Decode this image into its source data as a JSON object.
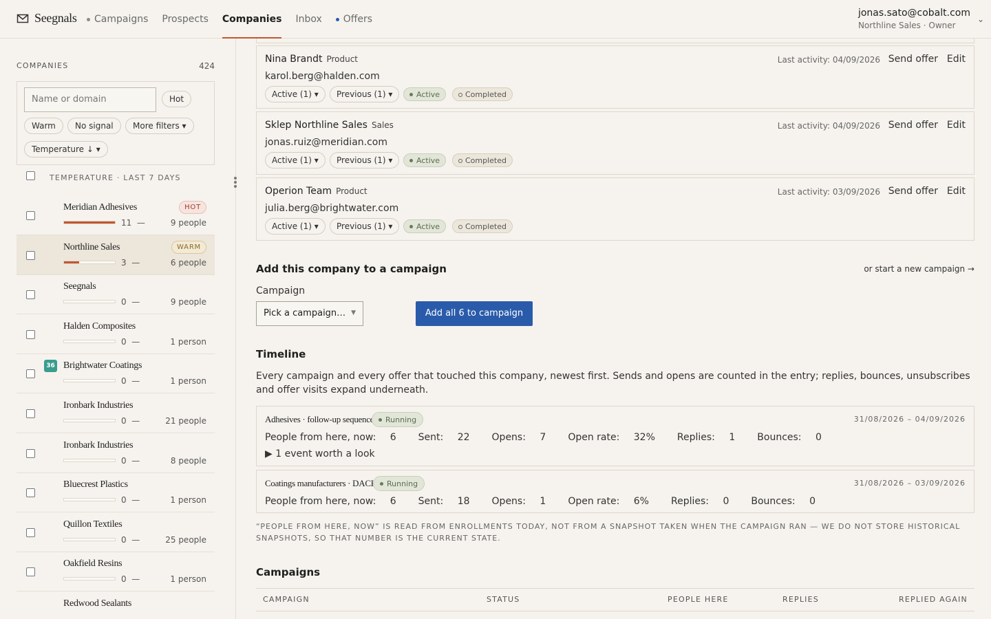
{
  "app": {
    "brand": "Seegnals",
    "nav": [
      {
        "label": "Campaigns",
        "dot": true,
        "dot_color": "#8a8a8a"
      },
      {
        "label": "Prospects",
        "dot": false
      },
      {
        "label": "Companies",
        "active": true
      },
      {
        "label": "Inbox",
        "dot": false
      },
      {
        "label": "Offers",
        "dot": true,
        "dot_color": "#2a5db0"
      }
    ],
    "account": {
      "email": "jonas.sato@cobalt.com",
      "org": "Northline Sales · Owner"
    }
  },
  "sidebar": {
    "title": "COMPANIES",
    "count": "424",
    "search_placeholder": "Name or domain",
    "chips": [
      "Hot",
      "Warm",
      "No signal",
      "More filters ▾",
      "Temperature ↓ ▾"
    ],
    "column_header": "TEMPERATURE · LAST 7 DAYS",
    "rows": [
      {
        "name": "Meridian Adhesives",
        "score": "11",
        "fill": 1.0,
        "people": "9 people",
        "badge": "HOT"
      },
      {
        "name": "Northline Sales",
        "score": "3",
        "fill": 0.3,
        "people": "6 people",
        "badge": "WARM",
        "selected": true
      },
      {
        "name": "Seegnals",
        "score": "0",
        "fill": 0,
        "people": "9 people"
      },
      {
        "name": "Halden Composites",
        "score": "0",
        "fill": 0,
        "people": "1 person"
      },
      {
        "name": "Brightwater Coatings",
        "score": "0",
        "fill": 0,
        "people": "1 person",
        "num": "36"
      },
      {
        "name": "Ironbark Industries",
        "score": "0",
        "fill": 0,
        "people": "21 people"
      },
      {
        "name": "Ironbark Industries",
        "score": "0",
        "fill": 0,
        "people": "8 people"
      },
      {
        "name": "Bluecrest Plastics",
        "score": "0",
        "fill": 0,
        "people": "1 person"
      },
      {
        "name": "Quillon Textiles",
        "score": "0",
        "fill": 0,
        "people": "25 people"
      },
      {
        "name": "Oakfield Resins",
        "score": "0",
        "fill": 0,
        "people": "1 person"
      },
      {
        "name": "Redwood Sealants",
        "score": "",
        "fill": 0,
        "people": ""
      }
    ],
    "dash": "—"
  },
  "people": [
    {
      "name": "Nina Brandt",
      "role": "Product",
      "email": "karol.berg@halden.com",
      "last": "Last activity: 04/09/2026"
    },
    {
      "name": "Sklep Northline Sales",
      "role": "Sales",
      "email": "jonas.ruiz@meridian.com",
      "last": "Last activity: 04/09/2026"
    },
    {
      "name": "Operion Team",
      "role": "Product",
      "email": "julia.berg@brightwater.com",
      "last": "Last activity: 03/09/2026"
    }
  ],
  "person_actions": {
    "send": "Send offer",
    "edit": "Edit",
    "active_pill": "Active (1) ▾",
    "previous_pill": "Previous (1) ▾",
    "status_active": "Active",
    "status_done": "Completed"
  },
  "add_campaign": {
    "title": "Add this company to a campaign",
    "new_link": "or start a new campaign →",
    "label": "Campaign",
    "select_value": "Pick a campaign…",
    "button": "Add all 6 to campaign"
  },
  "timeline": {
    "title": "Timeline",
    "description": "Every campaign and every offer that touched this company, newest first. Sends and opens are counted in the entry; replies, bounces, unsubscribes and offer visits expand underneath.",
    "entries": [
      {
        "name": "Adhesives · follow-up sequence",
        "status": "Running",
        "dates": "31/08/2026 – 04/09/2026",
        "stats": [
          [
            "People from here, now:",
            "6"
          ],
          [
            "Sent:",
            "22"
          ],
          [
            "Opens:",
            "7"
          ],
          [
            "Open rate:",
            "32%"
          ],
          [
            "Replies:",
            "1"
          ],
          [
            "Bounces:",
            "0"
          ]
        ],
        "expand": "▶  1 event worth a look"
      },
      {
        "name": "Coatings manufacturers · DACH",
        "status": "Running",
        "dates": "31/08/2026 – 03/09/2026",
        "stats": [
          [
            "People from here, now:",
            "6"
          ],
          [
            "Sent:",
            "18"
          ],
          [
            "Opens:",
            "1"
          ],
          [
            "Open rate:",
            "6%"
          ],
          [
            "Replies:",
            "0"
          ],
          [
            "Bounces:",
            "0"
          ]
        ]
      }
    ],
    "note": "“PEOPLE FROM HERE, NOW” IS READ FROM ENROLLMENTS TODAY, NOT FROM A SNAPSHOT TAKEN WHEN THE CAMPAIGN RAN — WE DO NOT STORE HISTORICAL SNAPSHOTS, SO THAT NUMBER IS THE CURRENT STATE."
  },
  "campaigns": {
    "title": "Campaigns",
    "columns": [
      "CAMPAIGN",
      "STATUS",
      "PEOPLE HERE",
      "REPLIES",
      "REPLIED AGAIN"
    ]
  },
  "colors": {
    "accent": "#c4552e",
    "primary": "#2a5bab",
    "background": "#f6f3ee"
  }
}
